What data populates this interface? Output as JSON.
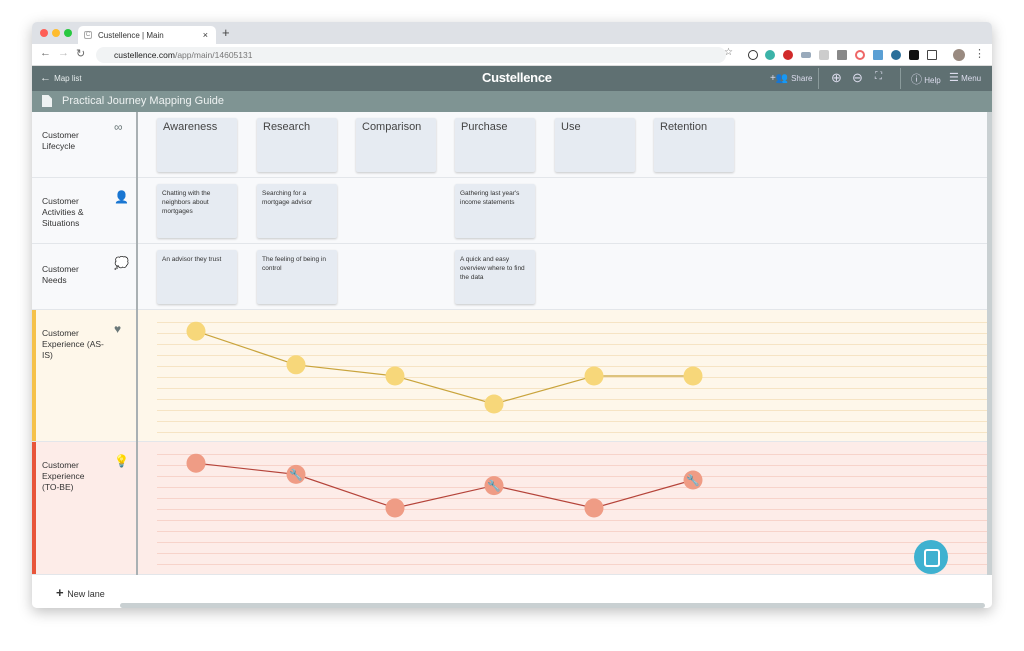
{
  "browser": {
    "tab_title": "Custellence | Main",
    "url_domain": "custellence.com",
    "url_path": "/app/main/14605131",
    "new_tab": "+",
    "close": "×"
  },
  "header": {
    "back_label": "Map list",
    "logo": "Custellence",
    "share_label": "Share",
    "help_label": "Help",
    "menu_label": "Menu"
  },
  "map_title": "Practical Journey Mapping Guide",
  "lanes": [
    {
      "label": "Customer Lifecycle",
      "icon": "infinity-icon"
    },
    {
      "label": "Customer Activities & Situations",
      "icon": "person-speaking-icon"
    },
    {
      "label": "Customer Needs",
      "icon": "thought-bubble-icon"
    },
    {
      "label": "Customer Experience (AS-IS)",
      "icon": "heart-icon",
      "color": "#f5c14a"
    },
    {
      "label": "Customer Experience (TO-BE)",
      "icon": "lightbulb-icon",
      "color": "#e8553a"
    }
  ],
  "stages": [
    "Awareness",
    "Research",
    "Comparison",
    "Purchase",
    "Use",
    "Retention"
  ],
  "activities": [
    "Chatting with the neighbors about mortgages",
    "Searching for a mortgage advisor",
    "",
    "Gathering last year's income statements",
    "",
    ""
  ],
  "needs": [
    "An advisor they trust",
    "The feeling of being in control",
    "",
    "A quick and easy overview where to find the data",
    "",
    ""
  ],
  "chart_data": [
    {
      "type": "line",
      "series": [
        {
          "name": "Customer Experience (AS-IS)",
          "values": [
            9,
            6,
            5,
            2.5,
            5,
            5
          ],
          "color": "#f7d77a",
          "line_color": "#c9a43c"
        }
      ],
      "categories": [
        "Awareness",
        "Research",
        "Comparison",
        "Purchase",
        "Use",
        "Retention"
      ],
      "ylim": [
        0,
        10
      ]
    },
    {
      "type": "line",
      "series": [
        {
          "name": "Customer Experience (TO-BE)",
          "values": [
            9,
            8,
            5,
            7,
            5,
            7.5
          ],
          "color": "#ef9c85",
          "line_color": "#b5443a",
          "wrench": [
            false,
            true,
            false,
            true,
            false,
            true
          ]
        }
      ],
      "categories": [
        "Awareness",
        "Research",
        "Comparison",
        "Purchase",
        "Use",
        "Retention"
      ],
      "ylim": [
        0,
        10
      ]
    }
  ],
  "footer": {
    "new_lane_label": "New lane"
  }
}
